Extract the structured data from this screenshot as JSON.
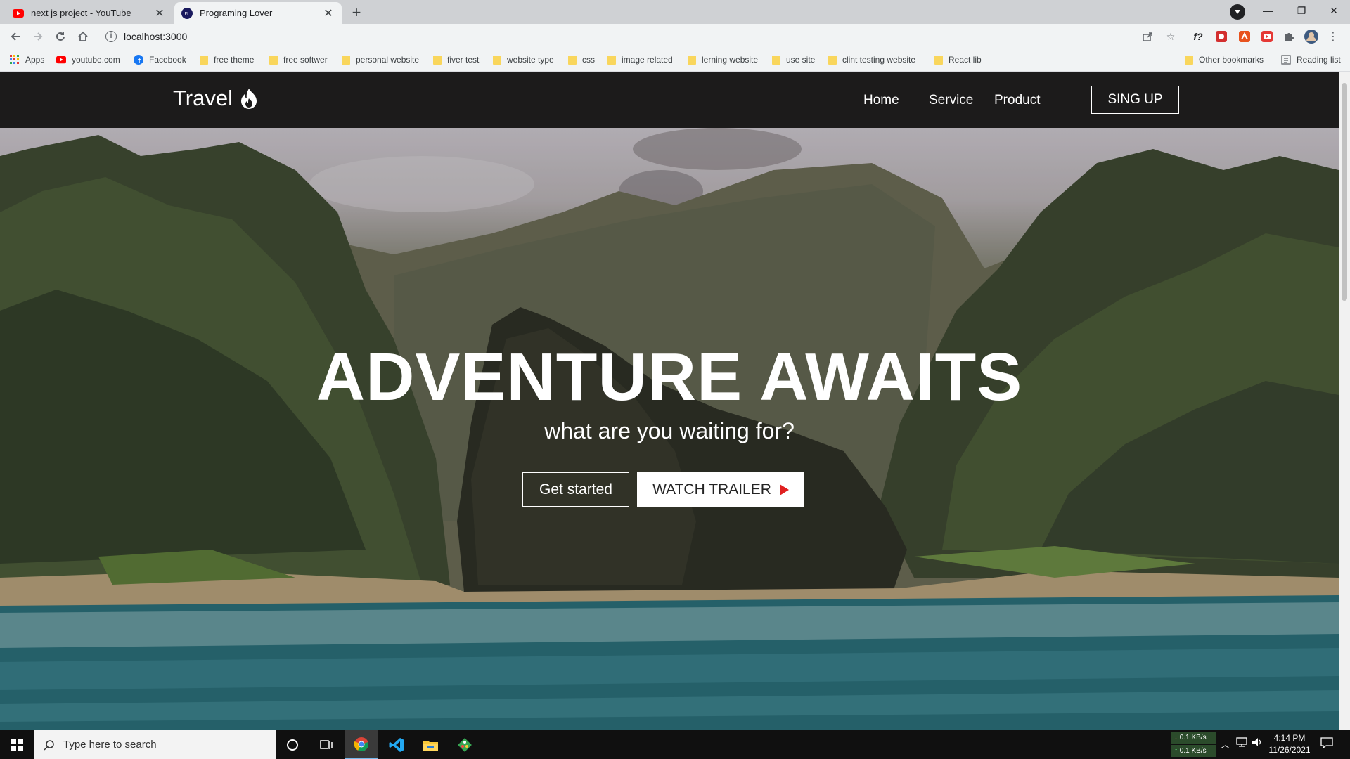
{
  "browser": {
    "tabs": [
      {
        "title": "next js project - YouTube",
        "active": false
      },
      {
        "title": "Programing Lover",
        "active": true
      }
    ],
    "url": "localhost:3000",
    "bookmarks": [
      {
        "label": "Apps",
        "icon": "apps-grid-icon"
      },
      {
        "label": "youtube.com",
        "icon": "youtube-icon"
      },
      {
        "label": "Facebook",
        "icon": "facebook-icon"
      },
      {
        "label": "free theme",
        "icon": "folder-icon"
      },
      {
        "label": "free softwer",
        "icon": "folder-icon"
      },
      {
        "label": "personal website",
        "icon": "folder-icon"
      },
      {
        "label": "fiver test",
        "icon": "folder-icon"
      },
      {
        "label": "website type",
        "icon": "folder-icon"
      },
      {
        "label": "css",
        "icon": "folder-icon"
      },
      {
        "label": "image related",
        "icon": "folder-icon"
      },
      {
        "label": "lerning website",
        "icon": "folder-icon"
      },
      {
        "label": "use site",
        "icon": "folder-icon"
      },
      {
        "label": "clint testing website",
        "icon": "folder-icon"
      },
      {
        "label": "React lib",
        "icon": "folder-icon"
      }
    ],
    "other_bookmarks": "Other bookmarks",
    "reading_list": "Reading list"
  },
  "page": {
    "logo": "Travel",
    "nav": [
      "Home",
      "Service",
      "Product"
    ],
    "signup": "SING UP",
    "hero_title": "ADVENTURE AWAITS",
    "hero_subtitle": "what are you waiting for?",
    "btn_primary": "Get started",
    "btn_secondary": "WATCH TRAILER"
  },
  "taskbar": {
    "search_placeholder": "Type here to search",
    "net_down": "0.1 KB/s",
    "net_up": "0.1 KB/s",
    "time": "4:14 PM",
    "date": "11/26/2021"
  },
  "colors": {
    "navbar_bg": "#1c1b1b",
    "play_icon": "#e02020",
    "youtube_red": "#ff0000",
    "facebook_blue": "#1877f2",
    "folder_yellow": "#f9d65c"
  }
}
